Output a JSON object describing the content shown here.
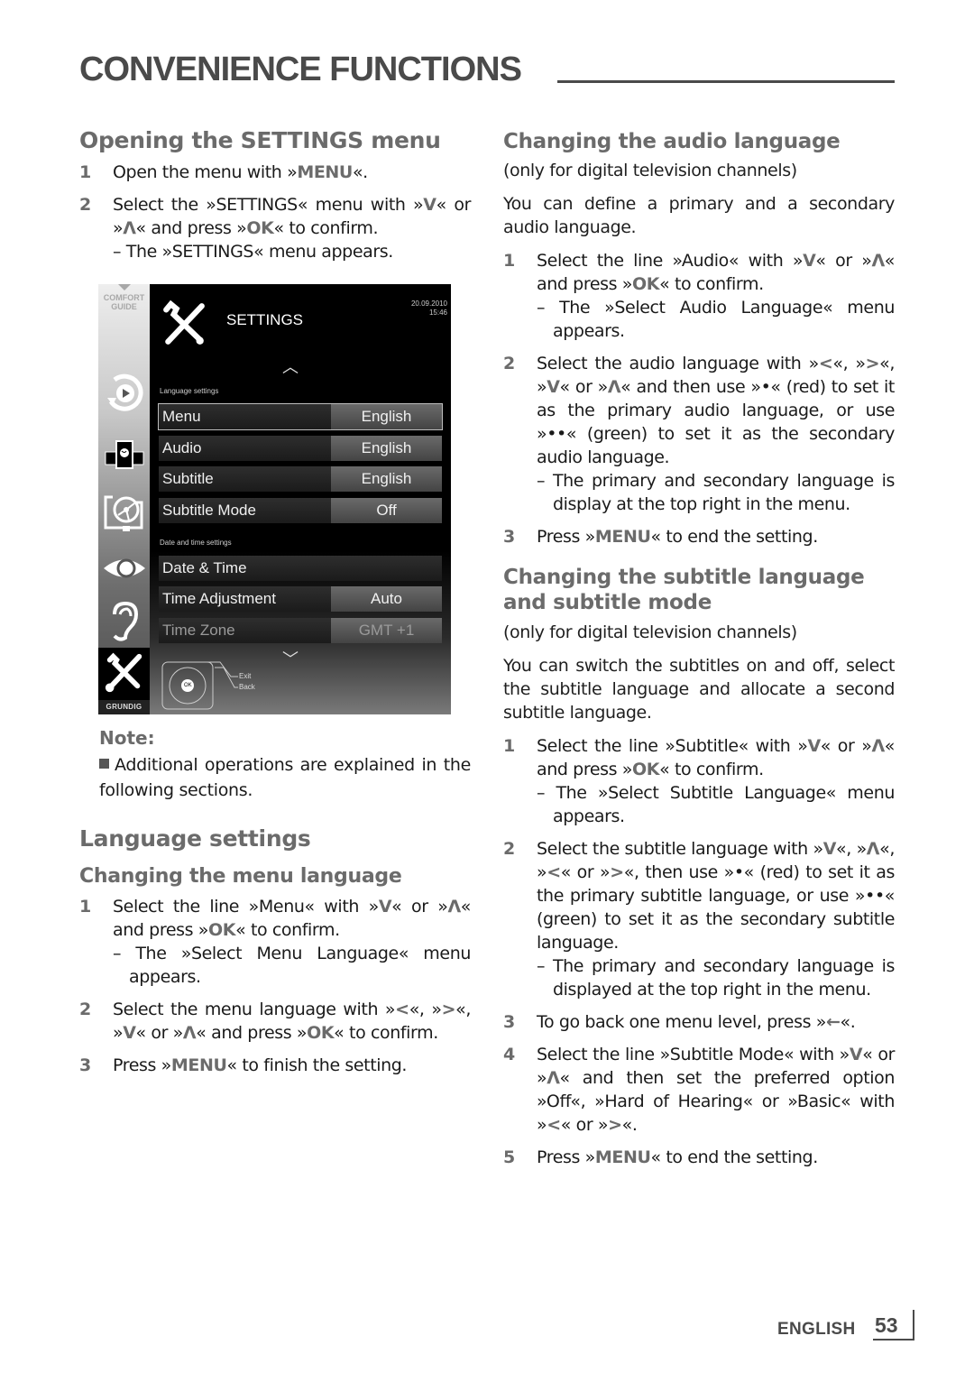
{
  "page": {
    "title": "CONVENIENCE FUNCTIONS",
    "footer_language": "ENGLISH",
    "page_number": "53"
  },
  "left": {
    "opening": {
      "heading": "Opening the SETTINGS menu",
      "steps": [
        {
          "num": "1",
          "parts": [
            {
              "t": "Open the menu with »"
            },
            {
              "k": "MENU"
            },
            {
              "t": "«."
            }
          ]
        },
        {
          "num": "2",
          "parts": [
            {
              "t": "Select the »SETTINGS« menu with »"
            },
            {
              "k": "V"
            },
            {
              "t": "« or »"
            },
            {
              "k": "Λ"
            },
            {
              "t": "« and press »"
            },
            {
              "k": "OK"
            },
            {
              "t": "« to confirm."
            }
          ],
          "result": "– The »SETTINGS« menu appears."
        }
      ]
    },
    "note": {
      "title": "Note:",
      "text": "Additional operations are explained in the following sections."
    },
    "language_settings": {
      "heading": "Language settings",
      "subheading": "Changing the menu language",
      "steps": [
        {
          "num": "1",
          "parts": [
            {
              "t": "Select the line »Menu« with »"
            },
            {
              "k": "V"
            },
            {
              "t": "« or »"
            },
            {
              "k": "Λ"
            },
            {
              "t": "« and press »"
            },
            {
              "k": "OK"
            },
            {
              "t": "« to confirm."
            }
          ],
          "result": "– The »Select Menu Language« menu appears."
        },
        {
          "num": "2",
          "parts": [
            {
              "t": "Select the menu language with »"
            },
            {
              "k": "<"
            },
            {
              "t": "«, »"
            },
            {
              "k": ">"
            },
            {
              "t": "«, »"
            },
            {
              "k": "V"
            },
            {
              "t": "« or »"
            },
            {
              "k": "Λ"
            },
            {
              "t": "« and press »"
            },
            {
              "k": "OK"
            },
            {
              "t": "« to confirm."
            }
          ]
        },
        {
          "num": "3",
          "parts": [
            {
              "t": "Press »"
            },
            {
              "k": "MENU"
            },
            {
              "t": "« to finish the setting."
            }
          ]
        }
      ]
    }
  },
  "tv": {
    "sidebar_label_line1": "COMFORT",
    "sidebar_label_line2": "GUIDE",
    "brand": "GRUNDIG",
    "title": "SETTINGS",
    "date": "20.09.2010",
    "time": "15:46",
    "group1": "Language settings",
    "rows1": [
      {
        "label": "Menu",
        "value": "English",
        "selected": true
      },
      {
        "label": "Audio",
        "value": "English"
      },
      {
        "label": "Subtitle",
        "value": "English"
      },
      {
        "label": "Subtitle Mode",
        "value": "Off"
      }
    ],
    "group2": "Date and time settings",
    "rows2": [
      {
        "label": "Date & Time",
        "value": null
      },
      {
        "label": "Time Adjustment",
        "value": "Auto"
      },
      {
        "label": "Time Zone",
        "value": "GMT +1",
        "disabled": true
      }
    ],
    "remote_ok": "OK",
    "exit_label": "Exit",
    "back_label": "Back"
  },
  "right": {
    "audio": {
      "heading": "Changing the audio language",
      "qualifier": "(only for digital television channels)",
      "intro": "You can define a primary and a secondary audio language.",
      "steps": [
        {
          "num": "1",
          "parts": [
            {
              "t": "Select the line »Audio« with »"
            },
            {
              "k": "V"
            },
            {
              "t": "« or »"
            },
            {
              "k": "Λ"
            },
            {
              "t": "« and press »"
            },
            {
              "k": "OK"
            },
            {
              "t": "« to confirm."
            }
          ],
          "result": "– The »Select Audio Language« menu appears."
        },
        {
          "num": "2",
          "parts": [
            {
              "t": "Select the audio language with »"
            },
            {
              "k": "<"
            },
            {
              "t": "«, »"
            },
            {
              "k": ">"
            },
            {
              "t": "«, »"
            },
            {
              "k": "V"
            },
            {
              "t": "« or »"
            },
            {
              "k": "Λ"
            },
            {
              "t": "« and then use »•« (red) to set it as the primary audio language, or use »••« (green) to set it as the secondary audio language."
            }
          ],
          "result": "– The primary and secondary language is display at the top right in the menu."
        },
        {
          "num": "3",
          "parts": [
            {
              "t": "Press »"
            },
            {
              "k": "MENU"
            },
            {
              "t": "« to end the setting."
            }
          ]
        }
      ]
    },
    "subtitle": {
      "heading": "Changing the subtitle language and subtitle mode",
      "qualifier": "(only for digital television channels)",
      "intro": "You can switch the subtitles on and off, select the subtitle language and allocate a second subtitle language.",
      "steps": [
        {
          "num": "1",
          "parts": [
            {
              "t": "Select the line »Subtitle« with »"
            },
            {
              "k": "V"
            },
            {
              "t": "« or »"
            },
            {
              "k": "Λ"
            },
            {
              "t": "« and press »"
            },
            {
              "k": "OK"
            },
            {
              "t": "« to confirm."
            }
          ],
          "result": "– The »Select Subtitle Language« menu appears."
        },
        {
          "num": "2",
          "parts": [
            {
              "t": "Select the subtitle language with »"
            },
            {
              "k": "V"
            },
            {
              "t": "«, »"
            },
            {
              "k": "Λ"
            },
            {
              "t": "«, »"
            },
            {
              "k": "<"
            },
            {
              "t": "« or »"
            },
            {
              "k": ">"
            },
            {
              "t": "«, then use »•« (red) to set it as the primary subtitle language, or use »••« (green) to set it as the secondary subtitle language."
            }
          ],
          "result": "– The primary and secondary language is displayed at the top right in the menu."
        },
        {
          "num": "3",
          "parts": [
            {
              "t": "To go back one menu level, press »"
            },
            {
              "k": "←"
            },
            {
              "t": "«."
            }
          ]
        },
        {
          "num": "4",
          "parts": [
            {
              "t": "Select the line »Subtitle Mode« with »"
            },
            {
              "k": "V"
            },
            {
              "t": "« or »"
            },
            {
              "k": "Λ"
            },
            {
              "t": "« and then set the preferred option »Off«, »Hard of Hearing« or »Basic« with »"
            },
            {
              "k": "<"
            },
            {
              "t": "« or »"
            },
            {
              "k": ">"
            },
            {
              "t": "«."
            }
          ]
        },
        {
          "num": "5",
          "parts": [
            {
              "t": "Press »"
            },
            {
              "k": "MENU"
            },
            {
              "t": "« to end the setting."
            }
          ]
        }
      ]
    }
  }
}
